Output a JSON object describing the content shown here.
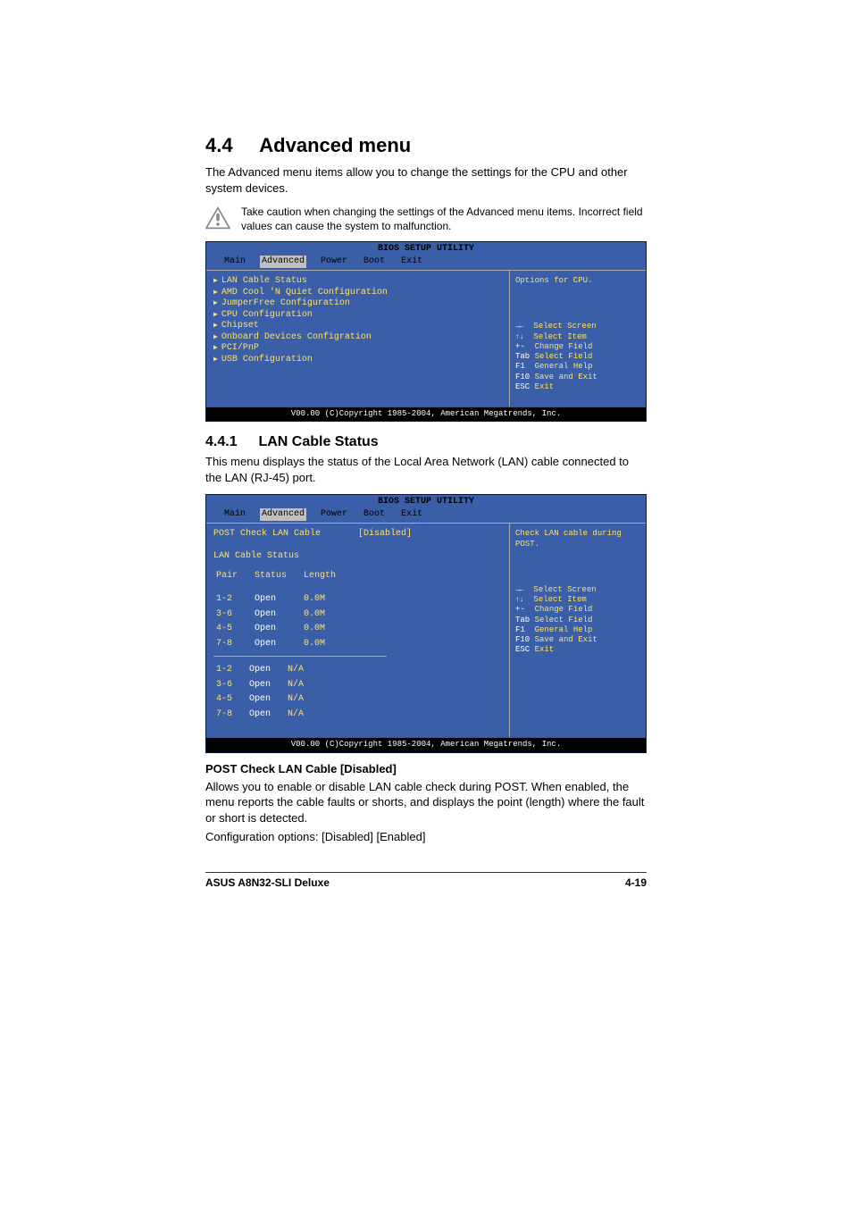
{
  "section": {
    "number": "4.4",
    "title": "Advanced menu",
    "intro": "The Advanced menu items allow you to change the settings for the CPU and other system devices.",
    "caution": "Take caution when changing the settings of the Advanced menu items. Incorrect field values can cause the system to malfunction."
  },
  "bios_common": {
    "title": "BIOS SETUP UTILITY",
    "tabs": {
      "main": "Main",
      "advanced": "Advanced",
      "power": "Power",
      "boot": "Boot",
      "exit": "Exit"
    },
    "footer": "V00.00 (C)Copyright 1985-2004, American Megatrends, Inc.",
    "help_keys": {
      "select_screen": "Select Screen",
      "select_item": "Select Item",
      "change_field": "Change Field",
      "select_field": "Select Field",
      "general_help": "General Help",
      "save_exit": "Save and Exit",
      "exit": "Exit"
    },
    "key_hints": {
      "lr": "→←",
      "ud": "↑↓",
      "pm": "+-",
      "tab": "Tab",
      "f1": "F1",
      "f10": "F10",
      "esc": "ESC"
    }
  },
  "bios1": {
    "right_title": "Options for CPU.",
    "items": [
      "LAN Cable Status",
      "AMD Cool 'N Quiet Configuration",
      "JumperFree Configuration",
      "CPU Configuration",
      "Chipset",
      "Onboard Devices Configration",
      "PCI/PnP",
      "USB Configuration"
    ]
  },
  "subsection": {
    "number": "4.4.1",
    "title": "LAN Cable Status",
    "intro": "This menu displays the status of the Local Area Network (LAN) cable connected to the LAN (RJ-45) port."
  },
  "bios2": {
    "right_title": "Check LAN cable during POST.",
    "post_check_label": "POST Check LAN Cable",
    "post_check_value": "[Disabled]",
    "table_title": "LAN Cable Status",
    "headers": {
      "pair": "Pair",
      "status": "Status",
      "length": "Length"
    },
    "rows_a": [
      {
        "pair": "1-2",
        "status": "Open",
        "length": "0.0M"
      },
      {
        "pair": "3-6",
        "status": "Open",
        "length": "0.0M"
      },
      {
        "pair": "4-5",
        "status": "Open",
        "length": "0.0M"
      },
      {
        "pair": "7-8",
        "status": "Open",
        "length": "0.0M"
      }
    ],
    "rows_b": [
      {
        "pair": "1-2",
        "status": "Open",
        "length": "N/A"
      },
      {
        "pair": "3-6",
        "status": "Open",
        "length": "N/A"
      },
      {
        "pair": "4-5",
        "status": "Open",
        "length": "N/A"
      },
      {
        "pair": "7-8",
        "status": "Open",
        "length": "N/A"
      }
    ]
  },
  "post_check": {
    "heading": "POST Check LAN Cable [Disabled]",
    "body1": "Allows you to enable or disable LAN cable check during POST. When enabled, the menu reports the cable faults or shorts, and displays the point (length) where the fault or short is detected.",
    "body2": "Configuration options: [Disabled] [Enabled]"
  },
  "footer": {
    "left": "ASUS A8N32-SLI Deluxe",
    "right": "4-19"
  }
}
